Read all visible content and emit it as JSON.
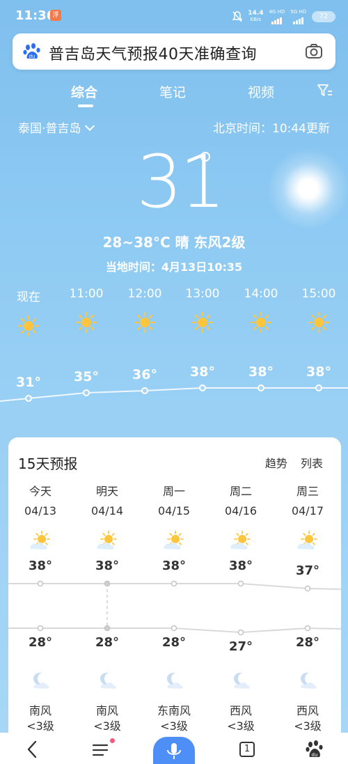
{
  "status_bar": {
    "time": "11:36",
    "badge": "浮",
    "speed": "14.4",
    "speed_unit": "KB/s",
    "net1": "4G HD",
    "net2": "5G HD",
    "battery": "72"
  },
  "search": {
    "query": "普吉岛天气预报40天准确查询"
  },
  "tabs": [
    {
      "label": "综合",
      "active": true
    },
    {
      "label": "笔记",
      "active": false
    },
    {
      "label": "视频",
      "active": false
    }
  ],
  "location": {
    "label": "泰国·普吉岛",
    "update_text": "北京时间：10:44更新"
  },
  "current": {
    "temperature": "31",
    "summary": "28~38°C 晴 东风2级",
    "local_time": "当地时间：4月13日10:35"
  },
  "hourly": [
    {
      "time": "现在",
      "temp": "31°",
      "icon": "sun-icon"
    },
    {
      "time": "11:00",
      "temp": "35°",
      "icon": "sun-icon"
    },
    {
      "time": "12:00",
      "temp": "36°",
      "icon": "sun-icon"
    },
    {
      "time": "13:00",
      "temp": "38°",
      "icon": "sun-icon"
    },
    {
      "time": "14:00",
      "temp": "38°",
      "icon": "sun-icon"
    },
    {
      "time": "15:00",
      "temp": "38°",
      "icon": "sun-icon"
    }
  ],
  "forecast": {
    "title": "15天预报",
    "links": [
      "趋势",
      "列表"
    ],
    "days": [
      {
        "day": "今天",
        "date": "04/13",
        "high": "38°",
        "low": "28°",
        "wind": "南风",
        "level": "<3级"
      },
      {
        "day": "明天",
        "date": "04/14",
        "high": "38°",
        "low": "28°",
        "wind": "南风",
        "level": "<3级"
      },
      {
        "day": "周一",
        "date": "04/15",
        "high": "38°",
        "low": "28°",
        "wind": "东南风",
        "level": "<3级"
      },
      {
        "day": "周二",
        "date": "04/16",
        "high": "38°",
        "low": "27°",
        "wind": "西风",
        "level": "<3级"
      },
      {
        "day": "周三",
        "date": "04/17",
        "high": "37°",
        "low": "28°",
        "wind": "西风",
        "level": "<3级"
      }
    ]
  },
  "bottom_nav": {
    "tab_count": "1"
  },
  "colors": {
    "sky_top": "#7fbfee",
    "accent": "#4e8ef7",
    "sun": "#ffc53d",
    "notify_dot": "#f25a7e"
  }
}
